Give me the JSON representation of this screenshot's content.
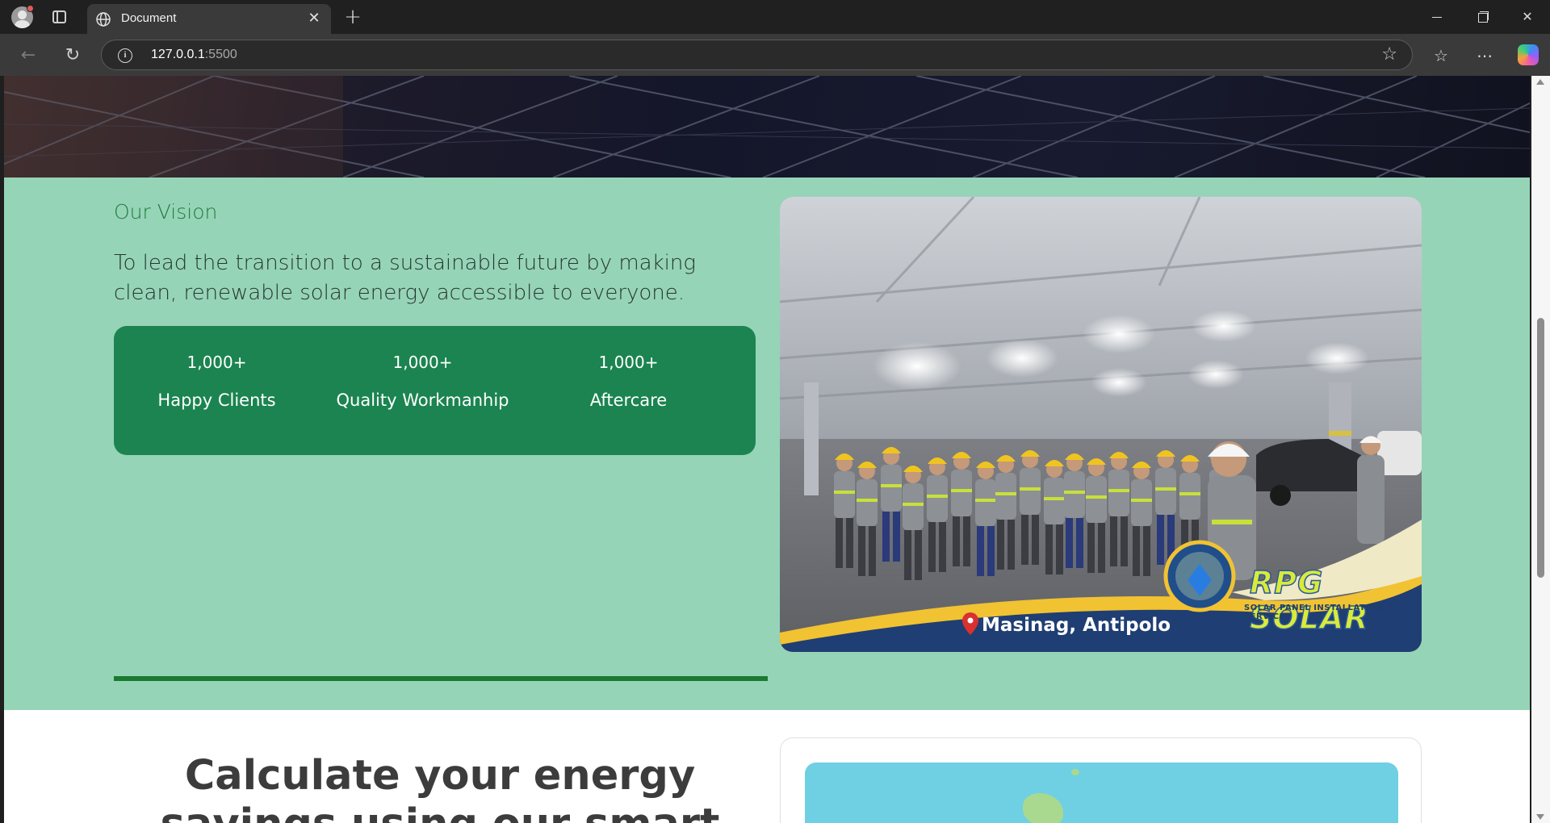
{
  "browser": {
    "tab_title": "Document",
    "tab_close": "✕",
    "new_tab": "+",
    "url_host": "127.0.0.1",
    "url_port": ":5500"
  },
  "vision": {
    "title": "Our Vision",
    "text": "To lead the transition to a sustainable future by making clean, renewable solar energy accessible to everyone.",
    "stats": [
      {
        "value": "1,000+",
        "label": "Happy Clients"
      },
      {
        "value": "1,000+",
        "label": "Quality Workmanhip"
      },
      {
        "value": "1,000+",
        "label": "Aftercare"
      }
    ],
    "photo": {
      "location": "Masinag, Antipolo",
      "brand": "RPG SOLAR",
      "brand_sub": "SOLAR PANEL INSTALLATION SERVICES"
    }
  },
  "calculator": {
    "title": "Calculate your energy savings using our smart"
  },
  "colors": {
    "vision_bg": "#96d4b7",
    "stats_bg": "#1b8450",
    "accent_green": "#1f7d3d"
  }
}
